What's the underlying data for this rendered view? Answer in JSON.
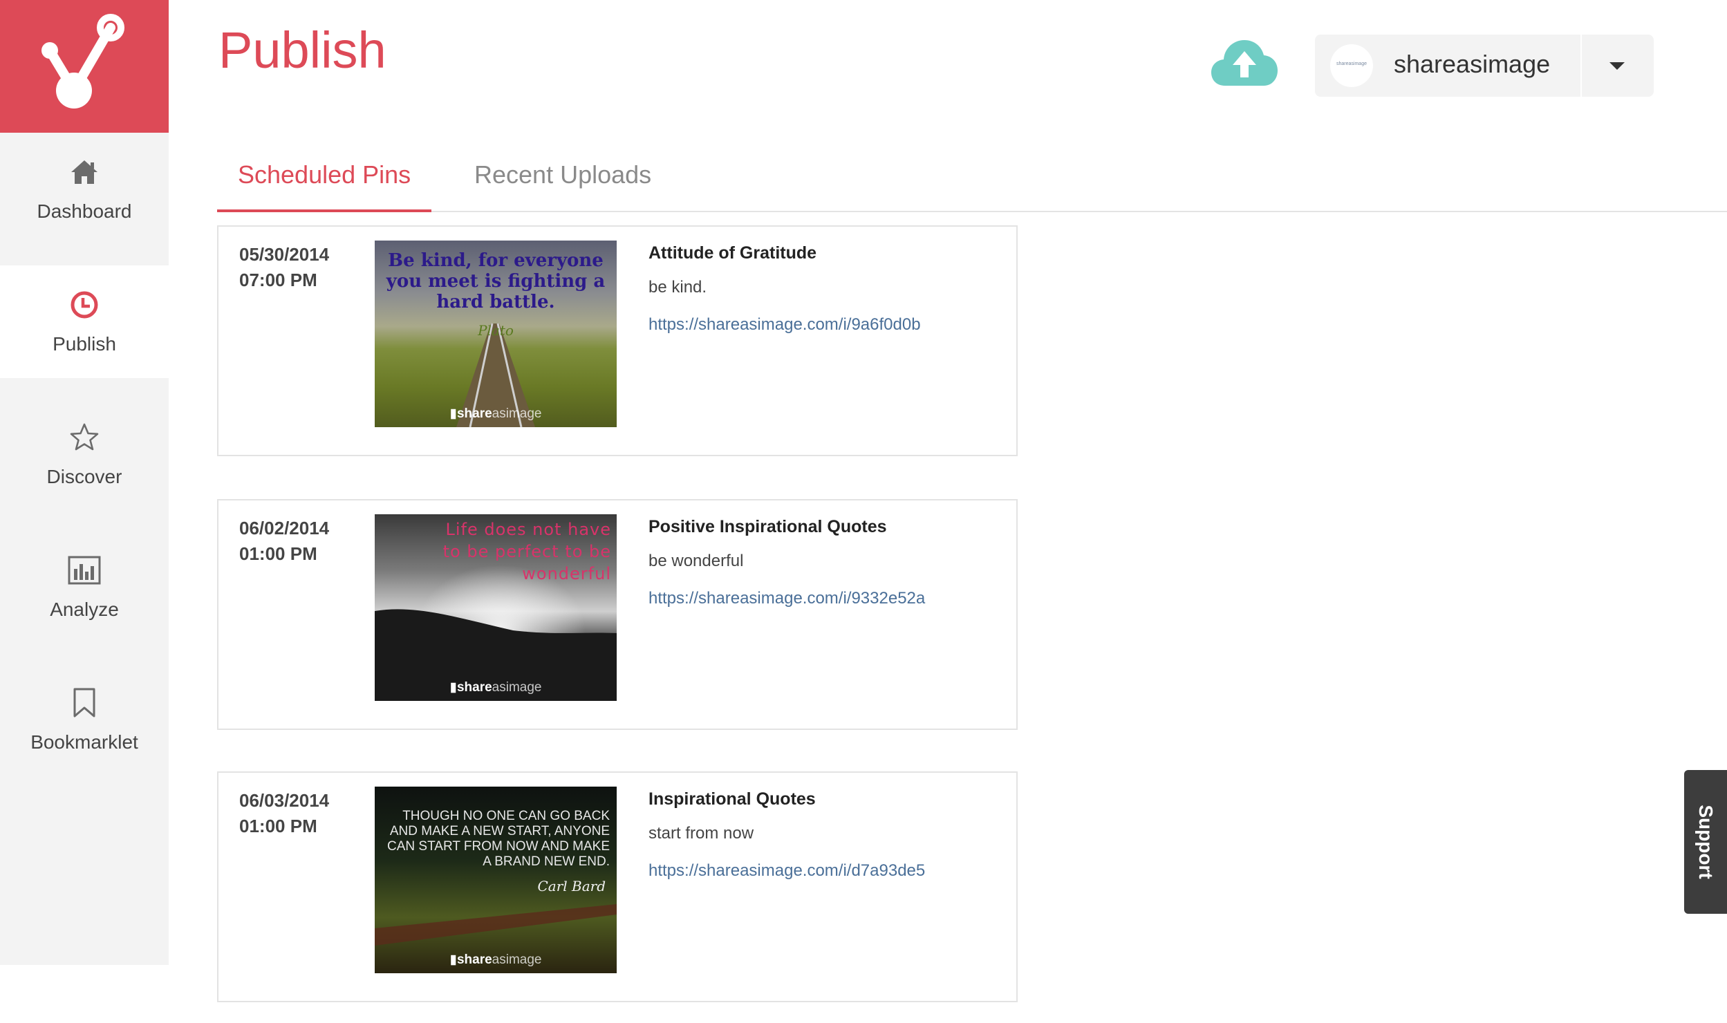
{
  "colors": {
    "brand": "#dd4a57",
    "accent_upload": "#6fcdc4",
    "link": "#4a6f98"
  },
  "sidebar": {
    "items": [
      {
        "label": "Dashboard",
        "icon": "home-icon"
      },
      {
        "label": "Publish",
        "icon": "clock-icon"
      },
      {
        "label": "Discover",
        "icon": "star-icon"
      },
      {
        "label": "Analyze",
        "icon": "bar-chart-icon"
      },
      {
        "label": "Bookmarklet",
        "icon": "bookmark-icon"
      }
    ]
  },
  "header": {
    "title": "Publish",
    "account": {
      "name": "shareasimage",
      "avatar_text": "shareasimage"
    }
  },
  "tabs": [
    {
      "label": "Scheduled Pins"
    },
    {
      "label": "Recent Uploads"
    }
  ],
  "pins": [
    {
      "date": "05/30/2014",
      "time": "07:00 PM",
      "title": "Attitude of Gratitude",
      "description": "be kind.",
      "url": "https://shareasimage.com/i/9a6f0d0b",
      "image_quote": "Be kind, for everyone you meet is fighting a hard battle.",
      "image_author": "Plato"
    },
    {
      "date": "06/02/2014",
      "time": "01:00 PM",
      "title": "Positive Inspirational Quotes",
      "description": "be wonderful",
      "url": "https://shareasimage.com/i/9332e52a",
      "image_quote": "Life does not have to be perfect to be wonderful"
    },
    {
      "date": "06/03/2014",
      "time": "01:00 PM",
      "title": "Inspirational Quotes",
      "description": "start from now",
      "url": "https://shareasimage.com/i/d7a93de5",
      "image_quote": "THOUGH NO ONE CAN GO BACK AND MAKE A NEW START, ANYONE CAN START FROM NOW AND MAKE A BRAND NEW END.",
      "image_author": "Carl Bard"
    }
  ],
  "watermark": {
    "bold": "share",
    "light": "asimage"
  },
  "support": {
    "label": "Support"
  }
}
